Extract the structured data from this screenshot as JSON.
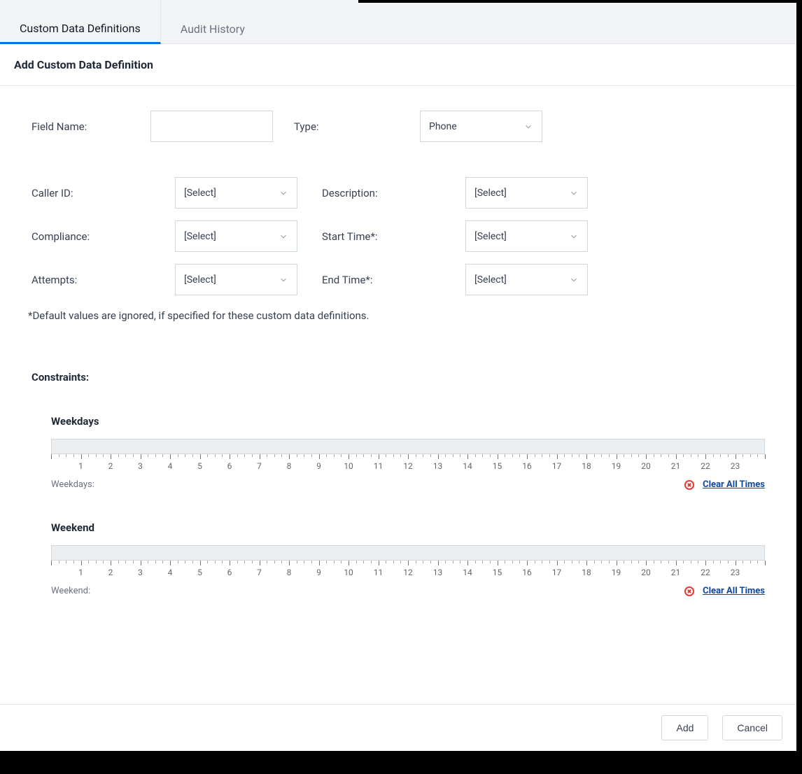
{
  "tabs": [
    "Custom Data Definitions",
    "Audit History"
  ],
  "active_tab_index": 0,
  "page_title": "Add Custom Data Definition",
  "fields": {
    "field_name": {
      "label": "Field Name:",
      "value": ""
    },
    "type": {
      "label": "Type:",
      "value": "Phone"
    },
    "caller_id": {
      "label": "Caller ID:",
      "value": "[Select]"
    },
    "description": {
      "label": "Description:",
      "value": "[Select]"
    },
    "compliance": {
      "label": "Compliance:",
      "value": "[Select]"
    },
    "start_time": {
      "label": "Start Time*:",
      "value": "[Select]"
    },
    "attempts": {
      "label": "Attempts:",
      "value": "[Select]"
    },
    "end_time": {
      "label": "End Time*:",
      "value": "[Select]"
    }
  },
  "footnote": "*Default values are ignored, if specified for these custom data definitions.",
  "constraints": {
    "title": "Constraints:",
    "groups": [
      {
        "heading": "Weekdays",
        "footer_label": "Weekdays:",
        "clear_label": "Clear All Times",
        "tick_labels": [
          "1",
          "2",
          "3",
          "4",
          "5",
          "6",
          "7",
          "8",
          "9",
          "10",
          "11",
          "12",
          "13",
          "14",
          "15",
          "16",
          "17",
          "18",
          "19",
          "20",
          "21",
          "22",
          "23"
        ]
      },
      {
        "heading": "Weekend",
        "footer_label": "Weekend:",
        "clear_label": "Clear All Times",
        "tick_labels": [
          "1",
          "2",
          "3",
          "4",
          "5",
          "6",
          "7",
          "8",
          "9",
          "10",
          "11",
          "12",
          "13",
          "14",
          "15",
          "16",
          "17",
          "18",
          "19",
          "20",
          "21",
          "22",
          "23"
        ]
      }
    ]
  },
  "buttons": {
    "add": "Add",
    "cancel": "Cancel"
  }
}
